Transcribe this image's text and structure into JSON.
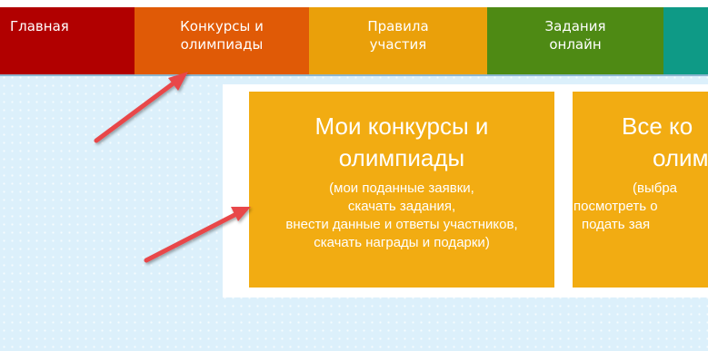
{
  "nav": {
    "home": "Главная",
    "contests": [
      "Конкурсы и",
      "олимпиады"
    ],
    "rules": [
      "Правила",
      "участия"
    ],
    "tasks": [
      "Задания",
      "онлайн"
    ]
  },
  "cards": {
    "mine": {
      "title": [
        "Мои конкурсы и",
        "олимпиады"
      ],
      "description": [
        "(мои поданные заявки,",
        "скачать задания,",
        "внести данные и ответы участников,",
        "скачать награды и подарки)"
      ]
    },
    "all": {
      "title": [
        "Все ко",
        "олим"
      ],
      "description": [
        "(выбра",
        "посмотреть о",
        "подать зая"
      ]
    }
  },
  "colors": {
    "background": "#dcf0fb",
    "home": "#b10000",
    "contests": "#e05a06",
    "rules": "#eaa00a",
    "tasks": "#4e8a14",
    "next": "#0e9a86",
    "card": "#f2ac12",
    "arrow": "#e8474a"
  }
}
